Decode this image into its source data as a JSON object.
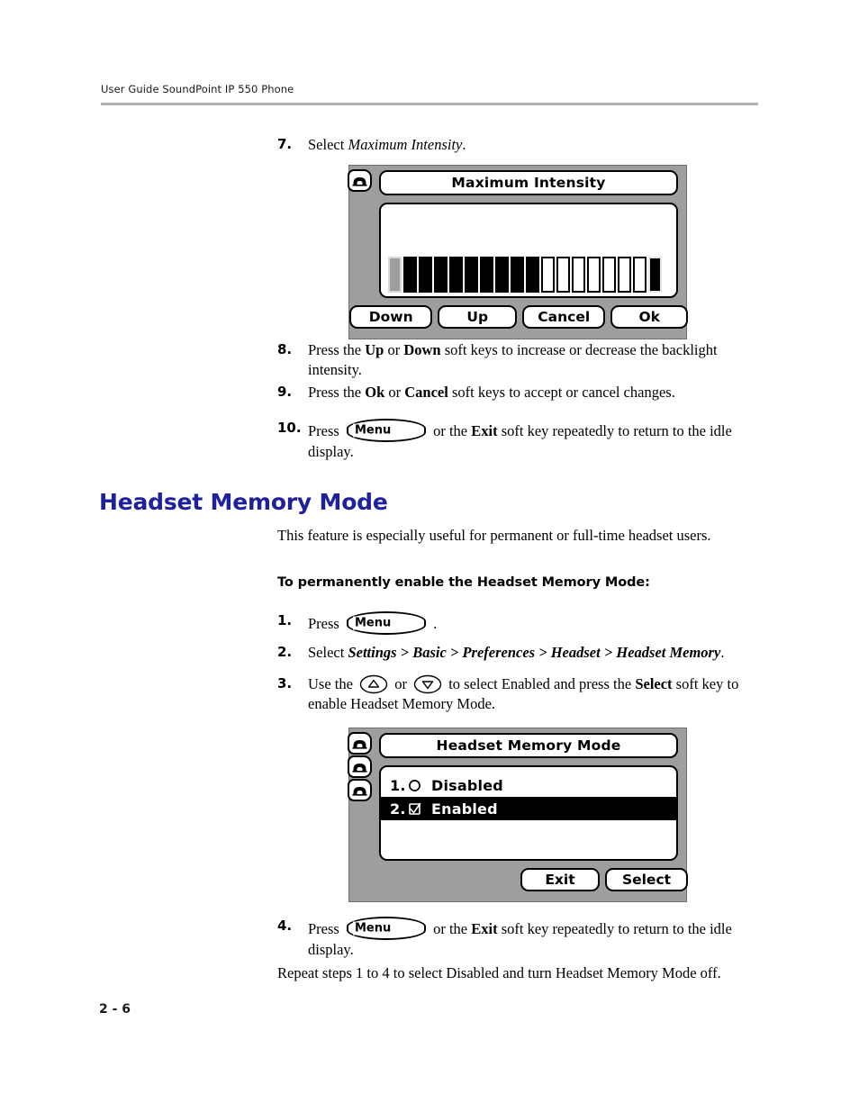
{
  "header": {
    "running_head": "User Guide SoundPoint IP 550 Phone"
  },
  "footer": {
    "page_number": "2 - 6"
  },
  "colors": {
    "heading_blue": "#1f209b",
    "rule_gray": "#b3b3b3",
    "phone_body_gray": "#9e9e9e"
  },
  "steps_backlight": [
    {
      "number": "7.",
      "pre": "Select ",
      "italic": "Maximum Intensity",
      "post": "."
    },
    {
      "number": "8.",
      "seg1": "Press the ",
      "bold1": "Up",
      "seg2": " or ",
      "bold2": "Down",
      "seg3": " soft keys to increase or decrease the backlight intensity."
    },
    {
      "number": "9.",
      "seg1": "Press the ",
      "bold1": "Ok",
      "seg2": " or ",
      "bold2": "Cancel",
      "seg3": " soft keys to accept or cancel changes."
    },
    {
      "number": "10.",
      "seg1": "Press ",
      "key_label": "Menu",
      "seg2": " or the ",
      "bold1": "Exit",
      "seg3": " soft key repeatedly to return to the idle display."
    }
  ],
  "figure_intensity": {
    "title": "Maximum Intensity",
    "line_key_count": 1,
    "gauge": {
      "cursor_bars": 1,
      "filled_bars": 9,
      "empty_bars": 7,
      "max_marker_bars": 1,
      "total_bars": 18
    },
    "soft_keys": [
      "Down",
      "Up",
      "Cancel",
      "Ok"
    ]
  },
  "section": {
    "heading": "Headset Memory Mode",
    "intro": "This feature is especially useful for permanent or full-time headset users.",
    "subheading": "To permanently enable the Headset Memory Mode:"
  },
  "steps_headset": [
    {
      "number": "1.",
      "seg1": "Press ",
      "key_label": "Menu",
      "seg2": " ."
    },
    {
      "number": "2.",
      "seg1": "Select ",
      "bolditalic": "Settings > Basic > Preferences > Headset > Headset Memory",
      "seg2": "."
    },
    {
      "number": "3.",
      "seg1": "Use the ",
      "key_up": "up-arrow",
      "seg2": " or ",
      "key_down": "down-arrow",
      "seg3": " to select Enabled and press the ",
      "bold1": "Select",
      "seg4": " soft key to enable Headset Memory Mode."
    },
    {
      "number": "4.",
      "seg1": "Press ",
      "key_label": "Menu",
      "seg2": " or the ",
      "bold1": "Exit",
      "seg3": " soft key repeatedly to return to the idle display."
    }
  ],
  "closing_note": "Repeat steps 1 to 4 to select Disabled and turn Headset Memory Mode off.",
  "figure_headset": {
    "title": "Headset Memory Mode",
    "line_key_count": 3,
    "list_items": [
      {
        "index": "1.",
        "checkbox": "unchecked-circle",
        "label": "Disabled",
        "selected": false
      },
      {
        "index": "2.",
        "checkbox": "checked-box",
        "label": "Enabled",
        "selected": true
      }
    ],
    "soft_keys": [
      "Exit",
      "Select"
    ]
  }
}
